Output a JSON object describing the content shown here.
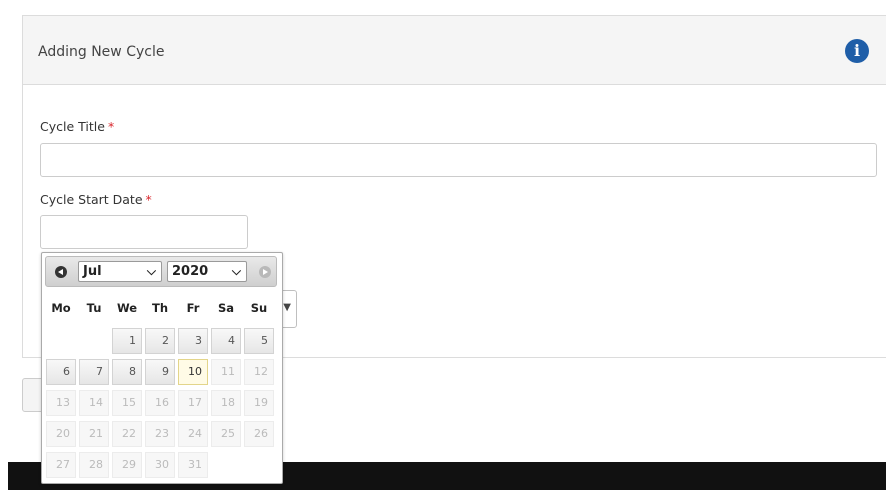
{
  "panel": {
    "title": "Adding New Cycle",
    "info_icon": "info-circle-icon"
  },
  "form": {
    "cycle_title_label": "Cycle Title",
    "cycle_title_value": "",
    "cycle_start_label": "Cycle Start Date",
    "cycle_start_value": "",
    "required_marker": "*"
  },
  "datepicker": {
    "month": "Jul",
    "year": "2020",
    "weekdays": [
      "Mo",
      "Tu",
      "We",
      "Th",
      "Fr",
      "Sa",
      "Su"
    ],
    "days": [
      "1",
      "2",
      "3",
      "4",
      "5",
      "6",
      "7",
      "8",
      "9",
      "10",
      "11",
      "12",
      "13",
      "14",
      "15",
      "16",
      "17",
      "18",
      "19",
      "20",
      "21",
      "22",
      "23",
      "24",
      "25",
      "26",
      "27",
      "28",
      "29",
      "30",
      "31"
    ],
    "first_weekday_index": 2,
    "today": "10",
    "last_enabled_day": "10",
    "prev_icon": "chevron-left-circle-icon",
    "next_icon": "chevron-right-circle-icon"
  },
  "colors": {
    "required": "#d9262c",
    "info": "#1f5ea8",
    "footer": "#111111"
  }
}
